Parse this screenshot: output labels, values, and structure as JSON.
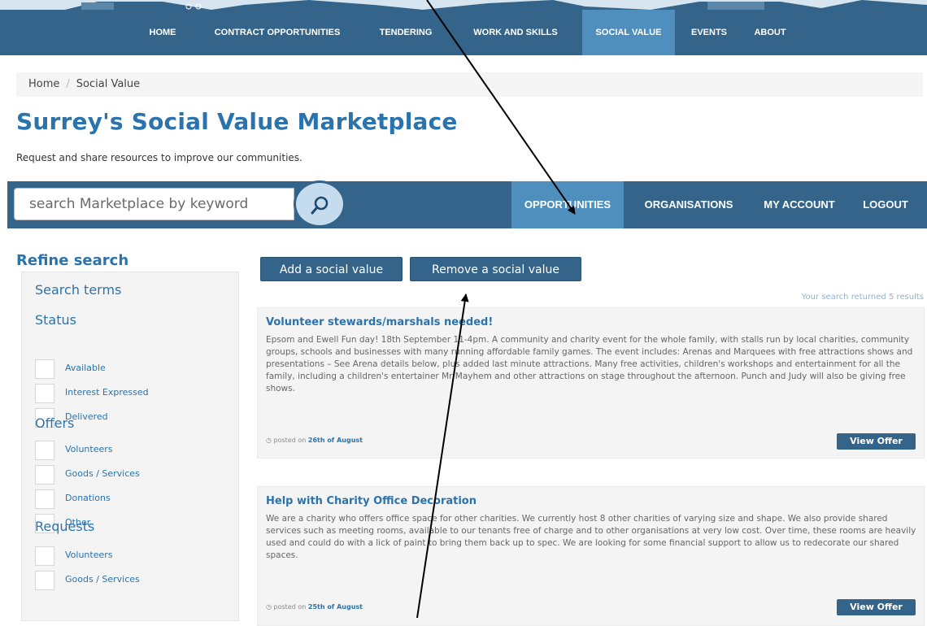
{
  "colors": {
    "header": "#34648a",
    "active_tab": "#4f8fbd",
    "title_blue": "#2b73ac",
    "card_bg": "#f4f4f4"
  },
  "nav": {
    "items": [
      {
        "label": "HOME",
        "active": false
      },
      {
        "label": "CONTRACT OPPORTUNITIES",
        "active": false
      },
      {
        "label": "TENDERING",
        "active": false
      },
      {
        "label": "WORK AND SKILLS",
        "active": false
      },
      {
        "label": "SOCIAL VALUE",
        "active": true
      },
      {
        "label": "EVENTS",
        "active": false
      },
      {
        "label": "ABOUT",
        "active": false
      }
    ]
  },
  "breadcrumb": {
    "home": "Home",
    "separator": "/",
    "current": "Social Value"
  },
  "page": {
    "title": "Surrey's Social Value Marketplace",
    "subtitle": "Request and share resources to improve our communities."
  },
  "search": {
    "placeholder": "search Marketplace by keyword",
    "button_icon": "search-icon"
  },
  "subnav": {
    "items": [
      {
        "label": "OPPORTUNITIES",
        "active": true
      },
      {
        "label": "ORGANISATIONS",
        "active": false
      },
      {
        "label": "MY ACCOUNT",
        "active": false
      },
      {
        "label": "LOGOUT",
        "active": false
      }
    ]
  },
  "sidebar": {
    "title": "Refine search",
    "search_terms": "Search terms",
    "status": {
      "heading": "Status",
      "items": [
        "Available",
        "Interest Expressed",
        "Delivered"
      ]
    },
    "offers": {
      "heading": "Offers",
      "items": [
        "Volunteers",
        "Goods / Services",
        "Donations",
        "Other"
      ]
    },
    "requests": {
      "heading": "Requests",
      "items": [
        "Volunteers",
        "Goods / Services"
      ]
    }
  },
  "actions": {
    "add": "Add a social value",
    "remove": "Remove a social value"
  },
  "results": {
    "count_text": "Your search returned 5 results",
    "items": [
      {
        "title": "Volunteer stewards/marshals needed!",
        "description": "Epsom and Ewell Fun day! 18th September 11-4pm. A community and charity event for the whole family, with stalls run by local charities, community groups, schools and businesses with many running affordable family games. The event includes: Arenas and Marquees with free attractions shows and presentations – See Arena details below, plus added last minute attractions. Many free activities, children's workshops and entertainment for all the family, including a children's entertainer Mr Mayhem and other attractions on stage throughout the afternoon. Punch and Judy will also be giving free shows.",
        "posted_prefix": "posted on",
        "posted_date": "26th of August",
        "button": "View Offer"
      },
      {
        "title": "Help with Charity Office Decoration",
        "description": "We are a charity who offers office space for other charities. We currently host 8 other charities of varying size and shape. We also provide shared services such as meeting rooms, available to our tenants free of charge and to other organisations at very low cost. Over time, these rooms are heavily used and could do with a lick of paint to bring them back up to spec. We are looking for some financial support to allow us to redecorate our shared spaces.",
        "posted_prefix": "posted on",
        "posted_date": "25th of August",
        "button": "View Offer"
      }
    ]
  }
}
